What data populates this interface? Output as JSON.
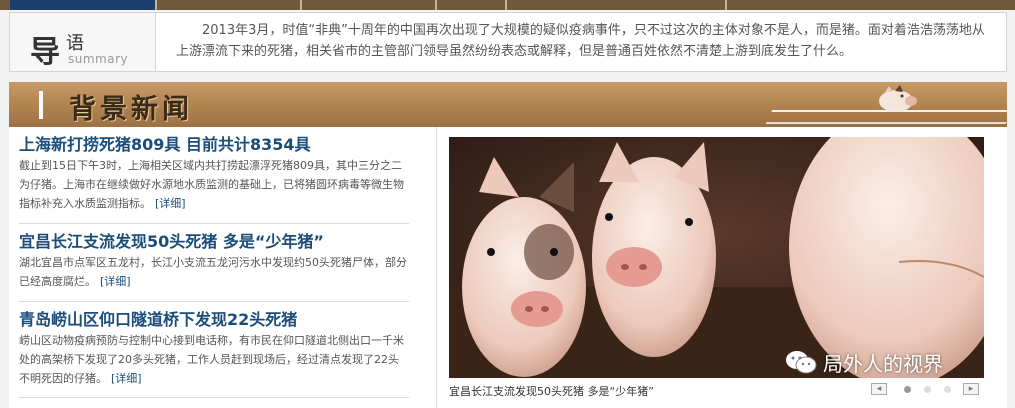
{
  "summary": {
    "label_zh_big": "导",
    "label_zh_small": "语",
    "label_en": "summary",
    "text": "2013年3月，时值“非典”十周年的中国再次出现了大规模的疑似疫病事件，只不过这次的主体对象不是人，而是猪。面对着浩浩荡荡地从上游漂流下来的死猪，相关省市的主管部门领导虽然纷纷表态或解释，但是普通百姓依然不清楚上游到底发生了什么。"
  },
  "banner": {
    "title": "背景新闻"
  },
  "news": [
    {
      "title": "上海新打捞死猪809具  目前共计8354具",
      "body": "截止到15日下午3时，上海相关区域内共打捞起漂浮死猪809具，其中三分之二为仔猪。上海市在继续做好水源地水质监测的基础上，已将猪圆环病毒等微生物指标补充入水质监测指标。",
      "more": "[详细]"
    },
    {
      "title": "宜昌长江支流发现50头死猪  多是“少年猪”",
      "body": "湖北宜昌市点军区五龙村，长江小支流五龙河污水中发现约50头死猪尸体，部分已经高度腐烂。",
      "more": "[详细]"
    },
    {
      "title": "青岛崂山区仰口隧道桥下发现22头死猪",
      "body": "崂山区动物疫病预防与控制中心接到电话称，有市民在仰口隧道北侧出口一千米处的高架桥下发现了20多头死猪，工作人员赶到现场后，经过清点发现了22头不明死因的仔猪。",
      "more": "[详细]"
    }
  ],
  "slideshow": {
    "caption": "宜昌长江支流发现50头死猪 多是“少年猪”",
    "prev": "◂",
    "next": "▸",
    "active_index": 0,
    "dot_count": 3
  },
  "watermark": {
    "text": "局外人的视界",
    "icon": "wechat-icon"
  }
}
